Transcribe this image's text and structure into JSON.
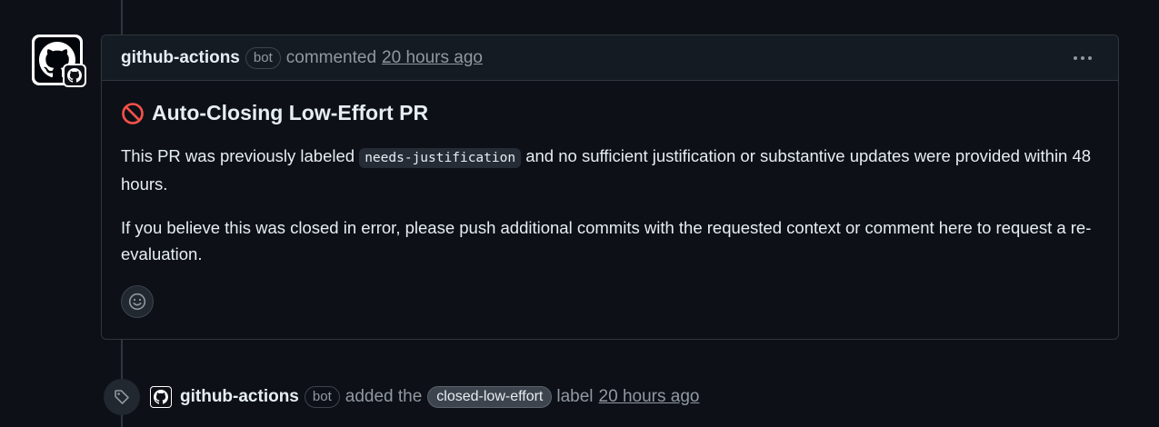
{
  "comment": {
    "author": "github-actions",
    "author_badge": "bot",
    "action": "commented",
    "time": "20 hours ago",
    "heading_icon": "no-entry-icon",
    "heading": "Auto-Closing Low-Effort PR",
    "para1_before": "This PR was previously labeled",
    "para1_code": "needs-justification",
    "para1_after": "and no sufficient justification or substantive updates were provided within 48 hours.",
    "para2": "If you believe this was closed in error, please push additional commits with the requested context or comment here to request a re-evaluation."
  },
  "event": {
    "icon": "tag-icon",
    "actor": "github-actions",
    "actor_badge": "bot",
    "action": "added the",
    "label": "closed-low-effort",
    "label_suffix": "label",
    "time": "20 hours ago"
  },
  "colors": {
    "background": "#0d1117",
    "border": "#30363d",
    "header_bg": "#151b23",
    "muted": "#9198a1",
    "danger": "#f85149"
  }
}
